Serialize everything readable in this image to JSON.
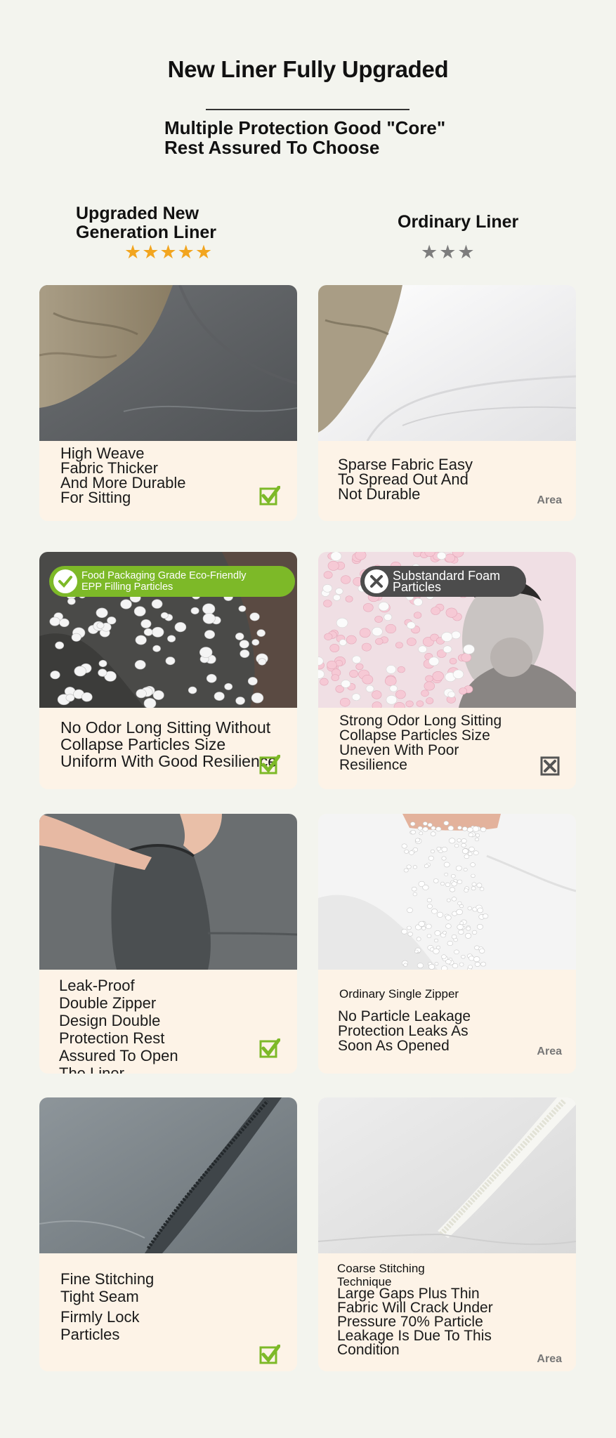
{
  "header": {
    "title": "New Liner Fully Upgraded",
    "subtitle_line1": "Multiple Protection Good \"Core\"",
    "subtitle_line2": "Rest Assured To Choose"
  },
  "columns": {
    "left": {
      "line1": "Upgraded New",
      "line2": "Generation Liner",
      "stars": "★★★★★",
      "rating": 5
    },
    "right": {
      "title": "Ordinary Liner",
      "stars": "★★★",
      "rating": 3
    }
  },
  "rows": [
    {
      "left": {
        "lines": [
          "High Weave",
          "Fabric Thicker",
          "And More Durable",
          "For Sitting"
        ]
      },
      "right": {
        "lines": [
          "Sparse Fabric Easy",
          "To Spread Out And",
          "Not Durable"
        ],
        "area": "Area"
      }
    },
    {
      "left": {
        "badge": {
          "line1": "Food Packaging Grade Eco-Friendly",
          "line2": "EPP Filling Particles"
        },
        "lines": [
          "No Odor Long Sitting Without",
          "Collapse Particles Size",
          "Uniform With Good Resilience"
        ]
      },
      "right": {
        "badge": {
          "line1": "Substandard Foam",
          "line2": "Particles"
        },
        "lines": [
          "Strong Odor Long Sitting",
          "Collapse Particles Size",
          "Uneven With Poor",
          "Resilience"
        ]
      }
    },
    {
      "left": {
        "lines": [
          "Leak-Proof",
          "Double Zipper",
          "Design Double",
          "Protection Rest",
          "Assured To Open",
          "The Liner"
        ]
      },
      "right": {
        "heading": "Ordinary Single Zipper",
        "lines": [
          "No Particle Leakage",
          "Protection Leaks As",
          "Soon As Opened"
        ],
        "area": "Area"
      }
    },
    {
      "left": {
        "lines": [
          "Fine Stitching",
          "Tight Seam",
          "Firmly Lock",
          "Particles"
        ]
      },
      "right": {
        "heading_lines": [
          "Coarse Stitching",
          "Technique"
        ],
        "lines": [
          "Large Gaps Plus Thin",
          "Fabric Will Crack Under",
          "Pressure 70% Particle",
          "Leakage Is Due To This",
          "Condition"
        ],
        "area": "Area"
      }
    }
  ],
  "icons": {
    "check": "check-box-icon",
    "cross": "cross-box-icon"
  },
  "colors": {
    "background": "#f3f4ee",
    "card": "#fdf3e7",
    "check_green": "#7db928",
    "star_gold": "#f2a51f",
    "star_gray": "#7d7d7d",
    "badge_green": "#7db928",
    "badge_gray": "#4c4c4c"
  }
}
